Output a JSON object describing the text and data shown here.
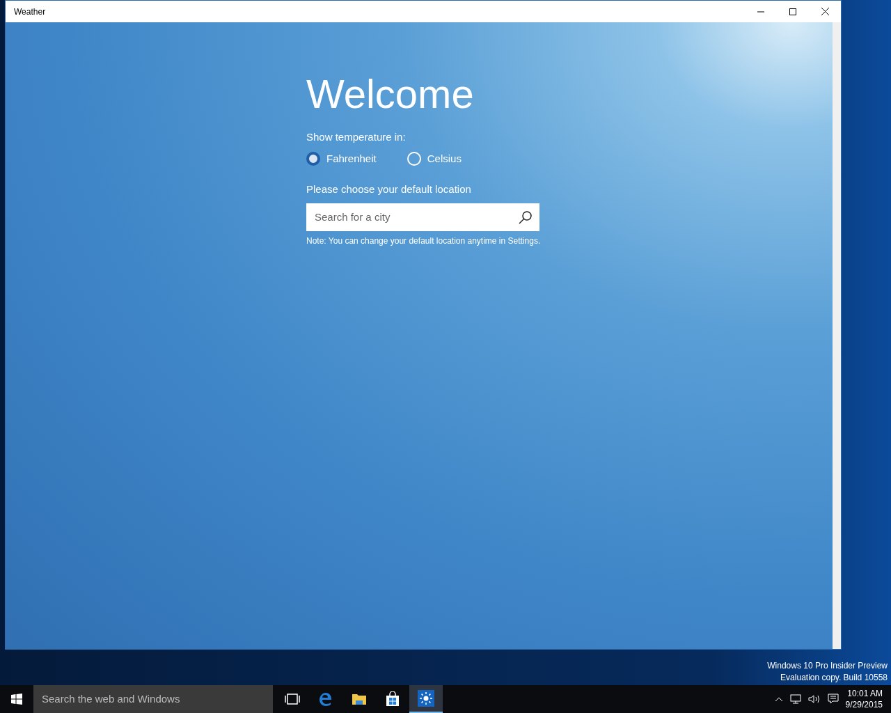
{
  "window": {
    "title": "Weather"
  },
  "welcome": {
    "heading": "Welcome",
    "units_label": "Show temperature in:",
    "units": [
      {
        "label": "Fahrenheit",
        "selected": true
      },
      {
        "label": "Celsius",
        "selected": false
      }
    ],
    "location_label": "Please choose your default location",
    "search": {
      "placeholder": "Search for a city"
    },
    "note": "Note: You can change your default location anytime in Settings."
  },
  "desktop": {
    "watermark_lines": [
      "Windows 10 Pro Insider Preview",
      "Evaluation copy. Build 10558"
    ]
  },
  "taskbar": {
    "search_placeholder": "Search the web and Windows",
    "apps": [
      {
        "kind": "taskview",
        "selected": false
      },
      {
        "kind": "edge",
        "selected": false
      },
      {
        "kind": "explorer",
        "selected": false
      },
      {
        "kind": "store",
        "selected": false
      },
      {
        "kind": "weather",
        "selected": true
      }
    ],
    "time": "10:01 AM",
    "date": "9/29/2015"
  }
}
